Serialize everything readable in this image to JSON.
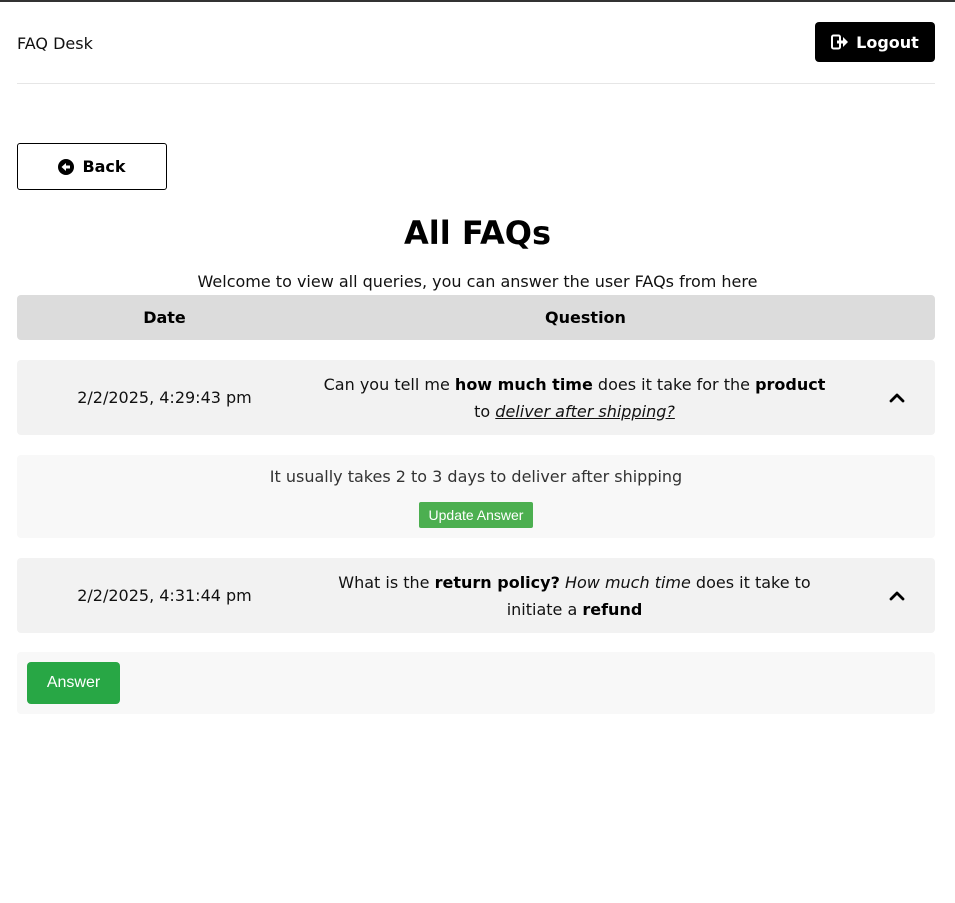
{
  "header": {
    "brand": "FAQ Desk",
    "logout_label": "Logout",
    "logout_icon": "logout-icon"
  },
  "nav": {
    "back_label": "Back",
    "back_icon": "arrow-circle-left-icon"
  },
  "page": {
    "title": "All FAQs",
    "subtitle": "Welcome to view all queries, you can answer the user FAQs from here"
  },
  "table": {
    "columns": [
      "Date",
      "Question"
    ]
  },
  "faqs": [
    {
      "date": "2/2/2025, 4:29:43 pm",
      "question_parts": [
        "Can you tell me ",
        "how much time",
        " does it take for the ",
        "product",
        "to ",
        "deliver after shipping?"
      ],
      "expanded": true,
      "answer": "It usually takes 2 to 3 days to deliver after shipping",
      "action_label": "Update Answer"
    },
    {
      "date": "2/2/2025, 4:31:44 pm",
      "question_parts": [
        "What is the ",
        "return policy?",
        " ",
        "How much time",
        " does it take to",
        "initiate a ",
        "refund"
      ],
      "expanded": true,
      "answer": "",
      "action_label": "Answer"
    }
  ],
  "colors": {
    "logout_bg": "#000000",
    "header_row_bg": "#dcdcdc",
    "faq_row_bg": "#f2f2f2",
    "answer_panel_bg": "#f8f8f8",
    "update_button": "#4caf50",
    "answer_button": "#28a745"
  }
}
